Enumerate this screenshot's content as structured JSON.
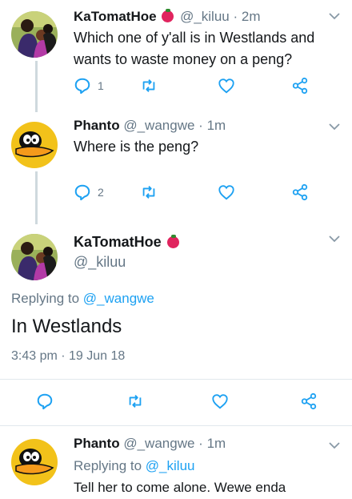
{
  "tweets": [
    {
      "name": "KaTomatHoe",
      "handle": "@_kiluu",
      "time": "2m",
      "text_lines": [
        "Which one of y'all is in Westlands and",
        "wants to waste money on a peng?"
      ],
      "reply_count": "1"
    },
    {
      "name": "Phanto",
      "handle": "@_wangwe",
      "time": "1m",
      "text_lines": [
        "Where is the peng?"
      ],
      "reply_count": "2"
    }
  ],
  "focus": {
    "name": "KaTomatHoe",
    "handle": "@_kiluu",
    "replying_prefix": "Replying to",
    "replying_mention": "@_wangwe",
    "text": "In Westlands",
    "timestamp": "3:43 pm · 19 Jun 18"
  },
  "reply": {
    "name": "Phanto",
    "handle": "@_wangwe",
    "time": "1m",
    "replying_prefix": "Replying to",
    "replying_mention": "@_kiluu",
    "text": "Tell her to come alone. Wewe enda"
  },
  "separator": "·",
  "icons": [
    "reply-icon",
    "retweet-icon",
    "like-icon",
    "share-icon",
    "chevron-down-icon"
  ],
  "colors": {
    "link": "#1da1f2",
    "secondary": "#657786",
    "thread_line": "#cfd9de"
  }
}
